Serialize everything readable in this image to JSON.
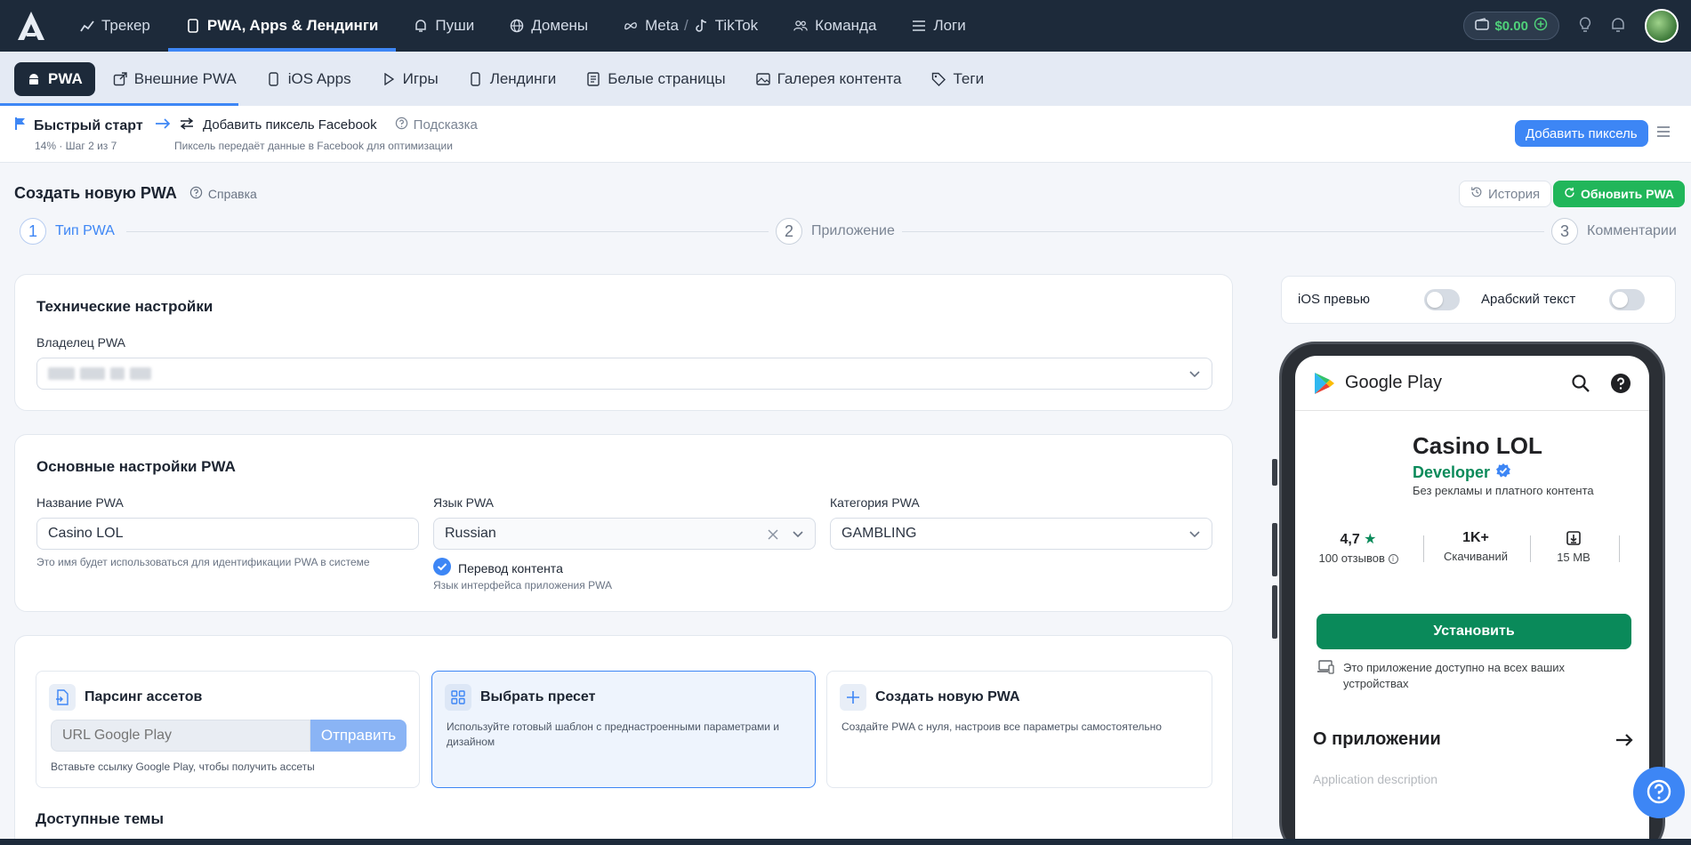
{
  "topnav": {
    "items": [
      {
        "label": "Трекер",
        "icon": "chart-icon"
      },
      {
        "label": "PWA, Apps & Лендинги",
        "icon": "phone-icon",
        "active": true
      },
      {
        "label": "Пуши",
        "icon": "bell-icon"
      },
      {
        "label": "Домены",
        "icon": "globe-icon"
      },
      {
        "label": "Meta",
        "icon": "meta-icon"
      },
      {
        "label": "/",
        "icon": ""
      },
      {
        "label": "TikTok",
        "icon": "tiktok-icon"
      },
      {
        "label": "Команда",
        "icon": "team-icon"
      },
      {
        "label": "Логи",
        "icon": "list-icon"
      }
    ],
    "balance": "$0.00"
  },
  "subnav": {
    "items": [
      {
        "label": "PWA",
        "active": true
      },
      {
        "label": "Внешние PWA"
      },
      {
        "label": "iOS Apps"
      },
      {
        "label": "Игры"
      },
      {
        "label": "Лендинги"
      },
      {
        "label": "Белые страницы"
      },
      {
        "label": "Галерея контента"
      },
      {
        "label": "Теги"
      }
    ]
  },
  "quickstart": {
    "title": "Быстрый старт",
    "progress": "14% · Шаг 2 из 7",
    "step_label": "Добавить пиксель Facebook",
    "hint": "Подсказка",
    "description": "Пиксель передаёт данные в Facebook для оптимизации",
    "button": "Добавить пиксель"
  },
  "create": {
    "title": "Создать новую PWA",
    "help": "Справка",
    "history": "История",
    "update": "Обновить PWA"
  },
  "stepper": [
    {
      "num": "1",
      "label": "Тип PWA"
    },
    {
      "num": "2",
      "label": "Приложение"
    },
    {
      "num": "3",
      "label": "Комментарии"
    }
  ],
  "tech": {
    "title": "Технические настройки",
    "owner_label": "Владелец PWA"
  },
  "basic": {
    "title": "Основные настройки PWA",
    "name_label": "Название PWA",
    "name_value": "Casino LOL",
    "name_hint": "Это имя будет использоваться для идентификации PWA в системе",
    "lang_label": "Язык PWA",
    "lang_value": "Russian",
    "translate_label": "Перевод контента",
    "lang_hint": "Язык интерфейса приложения PWA",
    "cat_label": "Категория PWA",
    "cat_value": "GAMBLING"
  },
  "options": {
    "parse": {
      "title": "Парсинг ассетов",
      "placeholder": "URL Google Play",
      "button": "Отправить",
      "hint": "Вставьте ссылку Google Play, чтобы получить ассеты"
    },
    "preset": {
      "title": "Выбрать пресет",
      "desc": "Используйте готовый шаблон с преднастроенными параметрами и дизайном"
    },
    "new": {
      "title": "Создать новую PWA",
      "desc": "Создайте PWA с нуля, настроив все параметры самостоятельно"
    },
    "themes_title": "Доступные темы"
  },
  "preview": {
    "ios_label": "iOS превью",
    "arabic_label": "Арабский текст",
    "store": "Google Play",
    "app_name": "Casino LOL",
    "developer": "Developer",
    "no_ads": "Без рекламы и платного контента",
    "rating": "4,7",
    "reviews": "100 отзывов",
    "downloads": "1K+",
    "downloads_label": "Скачиваний",
    "size": "15 MB",
    "install": "Установить",
    "available": "Это приложение доступно на всех ваших устройствах",
    "about": "О приложении",
    "app_description": "Application description"
  }
}
